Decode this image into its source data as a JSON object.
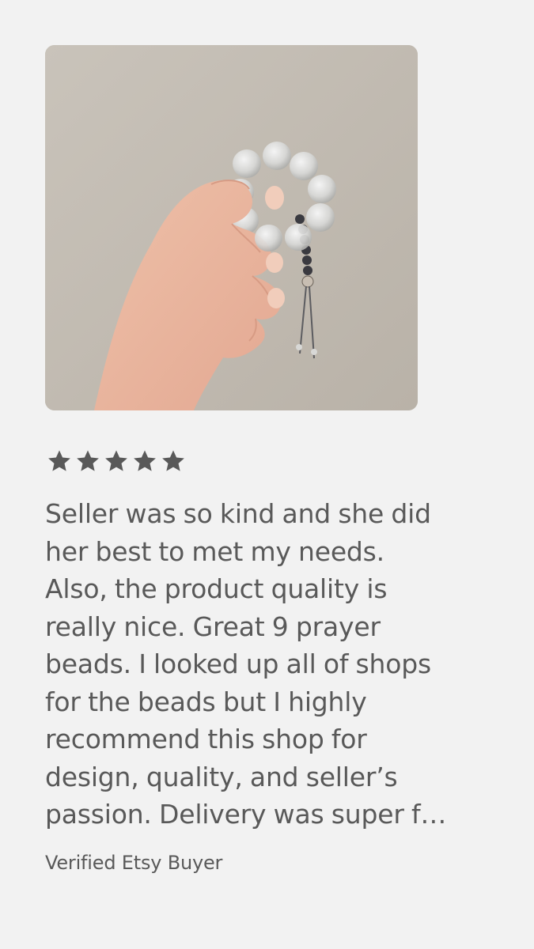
{
  "review": {
    "photo": {
      "subject": "hand-holding-white-bead-bracelet-icon"
    },
    "rating": {
      "stars": 5,
      "max": 5,
      "color": "#595959"
    },
    "text_lines": [
      "Seller was so kind and she did",
      "her best to met my needs.",
      "Also, the product quality is",
      "really nice. Great 9 prayer",
      "beads. I looked up all of shops",
      "for the beads but I highly",
      "recommend this shop for",
      "design, quality, and seller’s",
      "passion. Delivery was super f…"
    ],
    "reviewer": "Verified Etsy Buyer"
  },
  "colors": {
    "background": "#f2f2f2",
    "text": "#595959"
  }
}
